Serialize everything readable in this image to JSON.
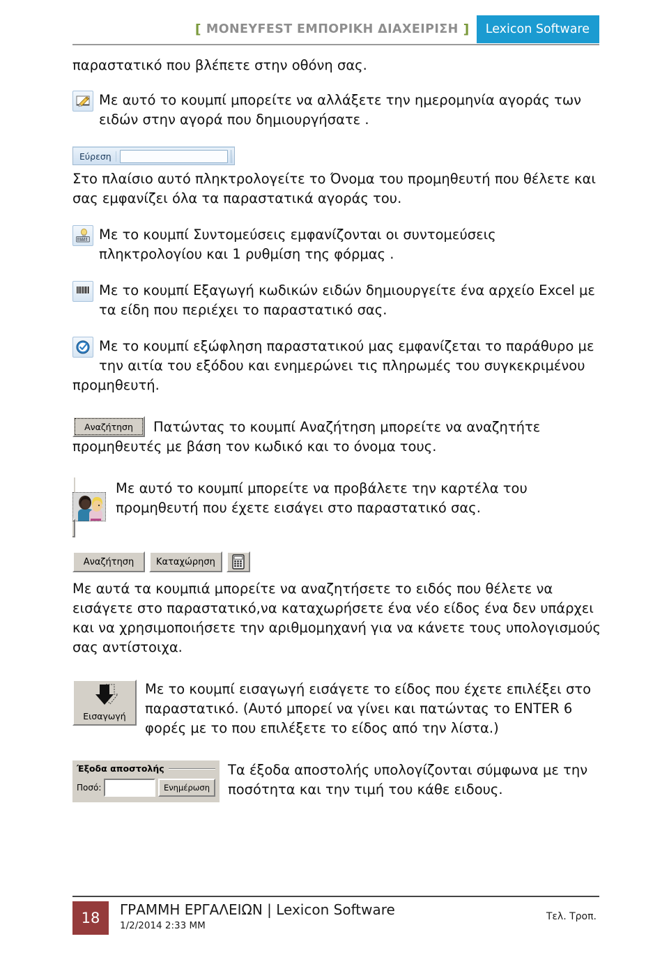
{
  "header": {
    "bracket_left": "[",
    "title": "MONEYFEST ΕΜΠΟΡΙΚΗ ΔΙΑΧΕΙΡΙΣΗ",
    "bracket_right": "]",
    "brand": "Lexicon Software",
    "brand_color": "#1b9bd1",
    "title_color": "#8e8e8e",
    "bracket_color": "#7b9a3d"
  },
  "body": {
    "intro_paragraph": "παραστατικό που βλέπετε στην οθόνη σας.",
    "sections": [
      {
        "icon": "edit-pencil-icon",
        "text": "Με αυτό το κουμπί μπορείτε να αλλάξετε την ημερομηνία αγοράς των ειδών στην αγορά που δημιουργήσατε ."
      },
      {
        "icon": "search-toolbar",
        "toolbar_label": "Εύρεση",
        "input_value": "",
        "text": "Στο πλαίσιο αυτό πληκτρολογείτε το Όνομα του προμηθευτή που θέλετε και σας εμφανίζει όλα τα παραστατικά αγοράς του."
      },
      {
        "icon": "keyboard-shortcuts-icon",
        "text": "Με το κουμπί Συντομεύσεις εμφανίζονται οι συντομεύσεις πληκτρολογίου και 1 ρυθμίση της φόρμας ."
      },
      {
        "icon": "barcode-icon",
        "text": "Με το κουμπί Εξαγωγή κωδικών ειδών δημιουργείτε ένα αρχείο Excel με τα είδη που περιέχει το παραστατικό σας."
      },
      {
        "icon": "check-circle-icon",
        "text": "Με το κουμπί εξώφληση παραστατικού μας εμφανίζεται το παράθυρο με την αιτία του εξόδου και ενημερώνει τις πληρωμές του συγκεκριμένου προμηθευτή."
      },
      {
        "icon": "search-button",
        "button_label": "Αναζήτηση",
        "text": "Πατώντας το κουμπί Αναζήτηση μπορείτε να αναζητήτε προμηθευτές με βάση τον κωδικό και το όνομα τους."
      },
      {
        "icon": "supplier-card-button",
        "text": "Με αυτό το κουμπί μπορείτε να προβάλετε την καρτέλα του προμηθευτή που έχετε εισάγει στο παραστατικό σας."
      },
      {
        "icon": "button-row",
        "buttons": [
          {
            "label": "Αναζήτηση",
            "name": "search-button"
          },
          {
            "label": "Καταχώρηση",
            "name": "register-button"
          },
          {
            "label": "",
            "name": "calculator-button"
          }
        ],
        "text": "Με αυτά τα κουμπιά μπορείτε να αναζητήσετε το ειδός που θέλετε να εισάγετε στο παραστατικό,να καταχωρήσετε ένα νέο είδος ένα δεν υπάρχει και να χρησιμοποιήσετε την αριθμομηχανή για να κάνετε τους υπολογισμούς σας αντίστοιχα."
      },
      {
        "icon": "import-button",
        "button_label": "Εισαγωγή",
        "text": "Με το κουμπί εισαγωγή εισάγετε το είδος που έχετε επιλέξει στο παραστατικό. (Αυτό μπορεί να γίνει και πατώντας το ENTER 6 φορές με το που επιλέξετε το είδος από την λίστα.)"
      },
      {
        "icon": "shipping-costs-groupbox",
        "groupbox_legend": "Έξοδα αποστολής",
        "field_label": "Ποσό:",
        "field_value": "",
        "update_button_label": "Ενημέρωση",
        "text": "Τα έξοδα αποστολής υπολογίζονται σύμφωνα με την ποσότητα και την τιμή του κάθε ειδους."
      }
    ]
  },
  "footer": {
    "page_number": "18",
    "title": "ΓΡΑΜΜΗ ΕΡΓΑΛΕΙΩΝ | Lexicon Software",
    "date": "1/2/2014 2:33 ΜΜ",
    "right_label": "Τελ. Τροπ.",
    "page_number_bg": "#953b3b"
  }
}
